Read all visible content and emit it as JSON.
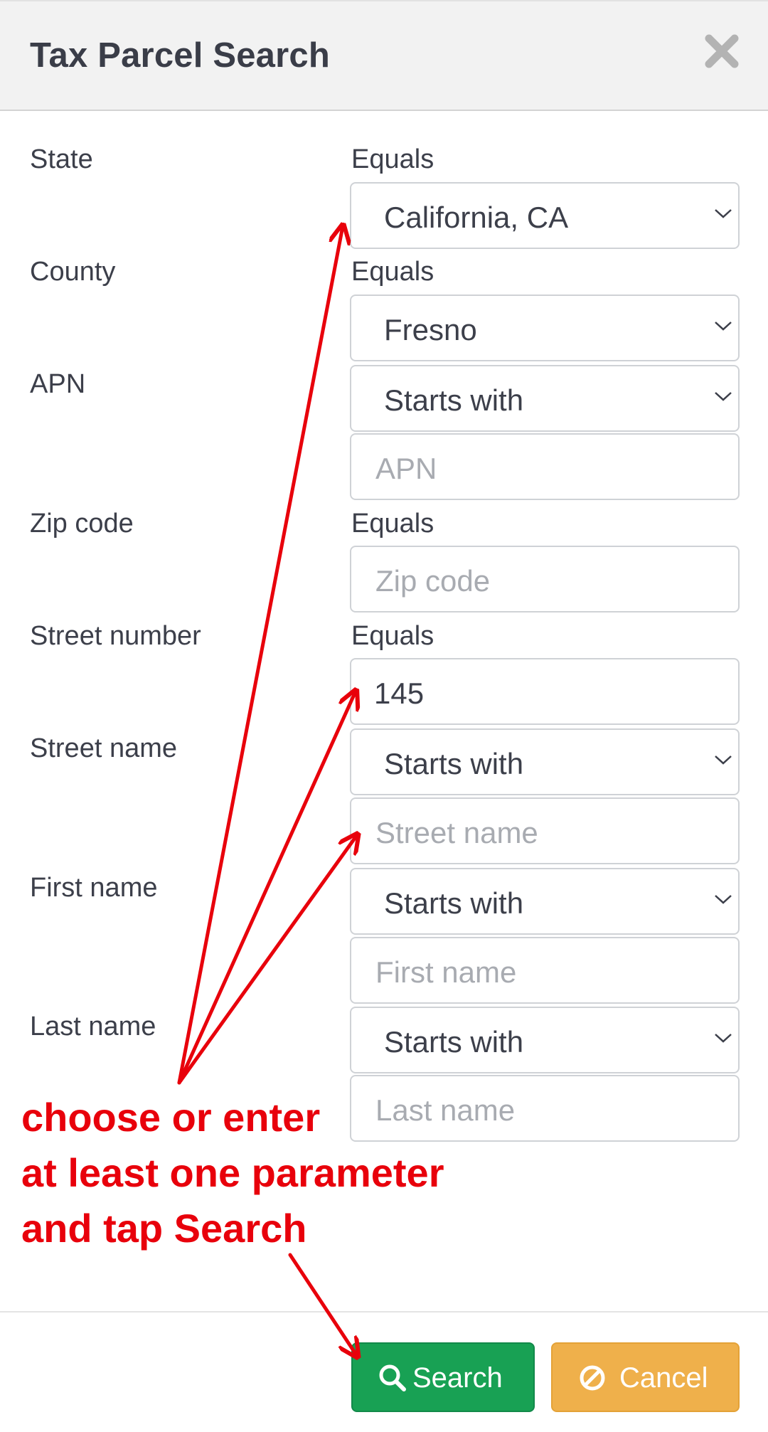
{
  "dialog": {
    "title": "Tax Parcel Search",
    "close_icon": "close-icon"
  },
  "fields": {
    "state": {
      "label": "State",
      "operator": "Equals",
      "value": "California, CA"
    },
    "county": {
      "label": "County",
      "operator": "Equals",
      "value": "Fresno"
    },
    "apn": {
      "label": "APN",
      "operator_select": "Starts with",
      "placeholder": "APN"
    },
    "zip": {
      "label": "Zip code",
      "operator": "Equals",
      "placeholder": "Zip code"
    },
    "street_number": {
      "label": "Street number",
      "operator": "Equals",
      "value": "145"
    },
    "street_name": {
      "label": "Street name",
      "operator_select": "Starts with",
      "placeholder": "Street name"
    },
    "first_name": {
      "label": "First name",
      "operator_select": "Starts with",
      "placeholder": "First name"
    },
    "last_name": {
      "label": "Last name",
      "operator_select": "Starts with",
      "placeholder": "Last name"
    }
  },
  "buttons": {
    "search": {
      "label": "Search",
      "icon": "search-icon",
      "color": "#18a154"
    },
    "cancel": {
      "label": "Cancel",
      "icon": "ban-icon",
      "color": "#efb04b"
    }
  },
  "annotation": {
    "lines": [
      "choose or enter",
      "at least one parameter",
      "and tap Search"
    ],
    "color": "#e8000b"
  }
}
